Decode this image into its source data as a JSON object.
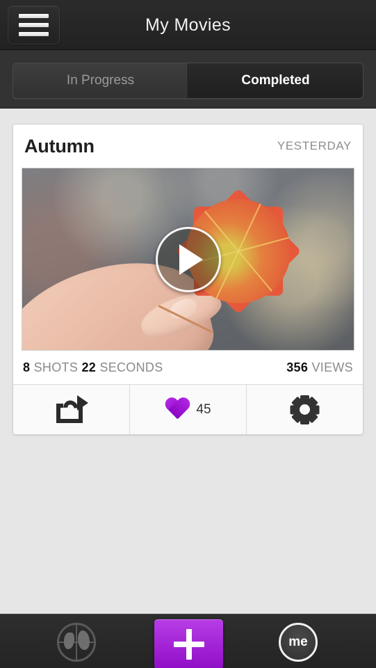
{
  "header": {
    "title": "My Movies",
    "menu_icon": "hamburger-menu-icon"
  },
  "tabs": [
    {
      "label": "In Progress",
      "active": false
    },
    {
      "label": "Completed",
      "active": true
    }
  ],
  "card": {
    "title": "Autumn",
    "date": "YESTERDAY",
    "thumbnail_alt": "hand holding an orange maple leaf",
    "play_icon": "play-icon",
    "stats": {
      "shots_value": "8",
      "shots_label": "SHOTS",
      "seconds_value": "22",
      "seconds_label": "SECONDS",
      "views_value": "356",
      "views_label": "VIEWS"
    },
    "actions": {
      "share_icon": "share-icon",
      "like_icon": "heart-icon",
      "like_count": "45",
      "settings_icon": "gear-icon"
    }
  },
  "bottom_nav": [
    {
      "name": "globe",
      "label": "",
      "icon": "globe-icon"
    },
    {
      "name": "add",
      "label": "+",
      "icon": "plus-icon"
    },
    {
      "name": "profile",
      "label": "me",
      "icon": "me-icon"
    }
  ],
  "colors": {
    "accent_purple": "#9f14d8",
    "header_dark": "#272727",
    "page_bg": "#e6e6e6",
    "card_bg": "#ffffff"
  }
}
